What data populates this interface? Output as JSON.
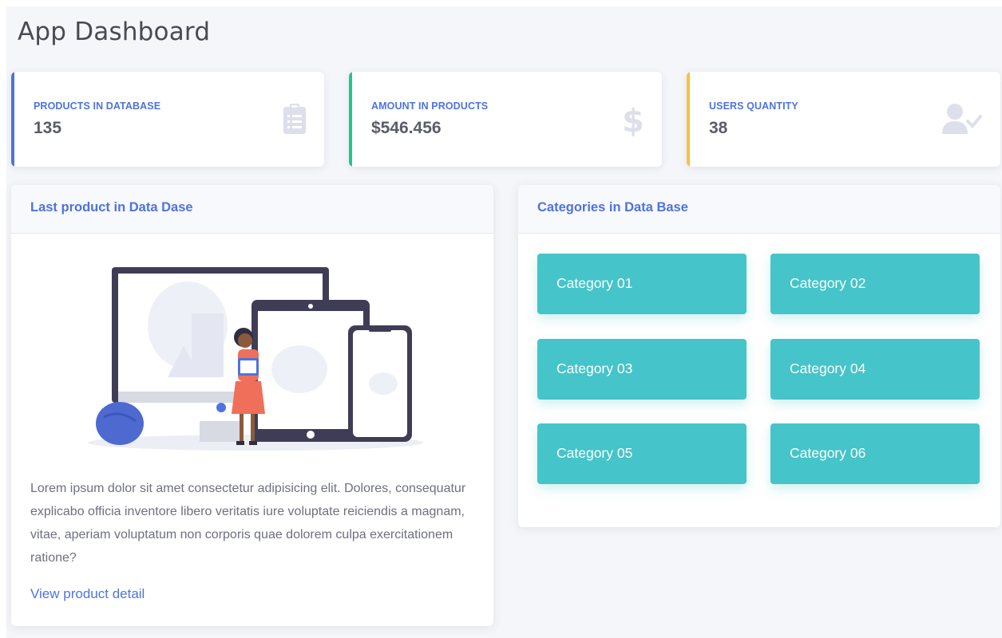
{
  "page": {
    "title": "App Dashboard"
  },
  "stats": [
    {
      "label": "PRODUCTS IN DATABASE",
      "value": "135",
      "color": "#4e73df",
      "icon": "clipboard-list-icon"
    },
    {
      "label": "AMOUNT IN PRODUCTS",
      "value": "$546.456",
      "color": "#1cc88a",
      "icon": "dollar-sign-icon"
    },
    {
      "label": "USERS QUANTITY",
      "value": "38",
      "color": "#f6c23e",
      "icon": "user-check-icon"
    }
  ],
  "last_product": {
    "header": "Last product in Data Dase",
    "description": "Lorem ipsum dolor sit amet consectetur adipisicing elit. Dolores, consequatur explicabo officia inventore libero veritatis iure voluptate reiciendis a magnam, vitae, aperiam voluptatum non corporis quae dolorem culpa exercitationem ratione?",
    "link": "View product detail"
  },
  "categories": {
    "header": "Categories in Data Base",
    "items": [
      "Category 01",
      "Category 02",
      "Category 03",
      "Category 04",
      "Category 05",
      "Category 06"
    ],
    "color": "#45c4c9"
  },
  "colors": {
    "accent": "#4e73df",
    "text": "#5a5c69",
    "muted": "#6e707e"
  }
}
